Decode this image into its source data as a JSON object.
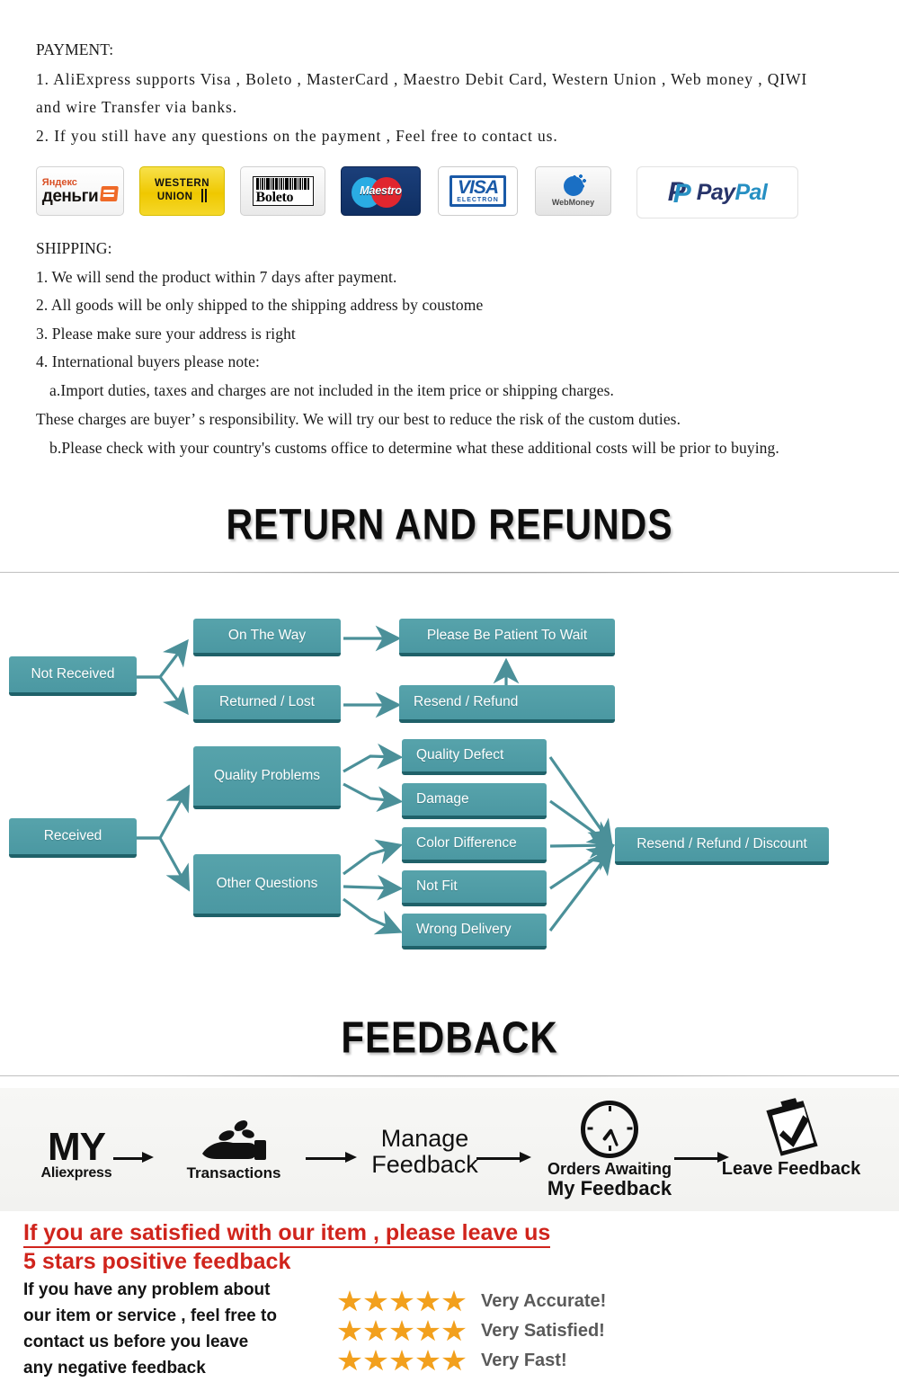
{
  "payment": {
    "heading": "PAYMENT:",
    "lines": [
      "1. AliExpress  supports Visa , Boleto , MasterCard , Maestro  Debit  Card, Western  Union , Web   money , QIWI",
      "and  wire  Transfer  via  banks.",
      "2.  If  you  still  have  any  questions  on  the  payment , Feel  free  to  contact  us."
    ],
    "logos": [
      {
        "name": "yandex-money-logo",
        "top": "Яндекс",
        "bottom": "деньги"
      },
      {
        "name": "western-union-logo",
        "line1": "WESTERN",
        "line2": "UNION"
      },
      {
        "name": "boleto-logo",
        "label": "Boleto"
      },
      {
        "name": "maestro-logo",
        "label": "Maestro"
      },
      {
        "name": "visa-electron-logo",
        "label": "VISA",
        "sub": "ELECTRON"
      },
      {
        "name": "webmoney-logo",
        "label": "WebMoney"
      },
      {
        "name": "paypal-logo",
        "label1": "Pay",
        "label2": "Pal"
      }
    ]
  },
  "shipping": {
    "heading": "SHIPPING:",
    "lines": [
      "1. We will send the product within 7 days after payment.",
      "2. All goods will be only shipped to the shipping address by coustome",
      "3. Please make sure your address is right",
      "4. International buyers please note:",
      "a.Import duties, taxes and charges are not included in the item price or shipping charges.",
      "These charges are buyer’ s responsibility. We will try our best to reduce the risk of the custom duties.",
      "b.Please check with your country's customs office to determine what these additional costs will be prior  to buying."
    ]
  },
  "returns": {
    "title": "RETURN AND REFUNDS",
    "nodes": {
      "not_received": "Not Received",
      "on_the_way": "On The Way",
      "returned_lost": "Returned / Lost",
      "please_be_patient": "Please Be Patient To Wait",
      "resend_refund": "Resend / Refund",
      "received": "Received",
      "quality_problems": "Quality Problems",
      "other_questions": "Other Questions",
      "quality_defect": "Quality Defect",
      "damage": "Damage",
      "color_difference": "Color Difference",
      "not_fit": "Not Fit",
      "wrong_delivery": "Wrong Delivery",
      "resend_refund_discount": "Resend / Refund / Discount"
    },
    "node_color": "#4b98a2",
    "node_edge_color": "#1f6169",
    "arrow_color": "#4b9099"
  },
  "feedback": {
    "title": "FEEDBACK",
    "steps": [
      {
        "name": "step-my-aliexpress",
        "big": "MY",
        "sub": "Aliexpress"
      },
      {
        "name": "step-transactions",
        "label": "Transactions"
      },
      {
        "name": "step-manage-feedback",
        "line1": "Manage",
        "line2": "Feedback"
      },
      {
        "name": "step-orders-awaiting",
        "line1": "Orders Awaiting",
        "line2": "My Feedback"
      },
      {
        "name": "step-leave-feedback",
        "label": "Leave Feedback"
      }
    ],
    "note_red_line1": "If you are satisfied with our item , please leave us",
    "note_red_line2": "5 stars positive feedback",
    "note_black": [
      "If you have any problem about",
      "our item or service , feel free to",
      "contact us before you  leave",
      "any negative feedback"
    ],
    "ratings": [
      {
        "stars": 5,
        "label": "Very Accurate!"
      },
      {
        "stars": 5,
        "label": "Very Satisfied!"
      },
      {
        "stars": 5,
        "label": "Very Fast!"
      }
    ],
    "star_color": "#f2a01d",
    "red_color": "#d0241c"
  }
}
